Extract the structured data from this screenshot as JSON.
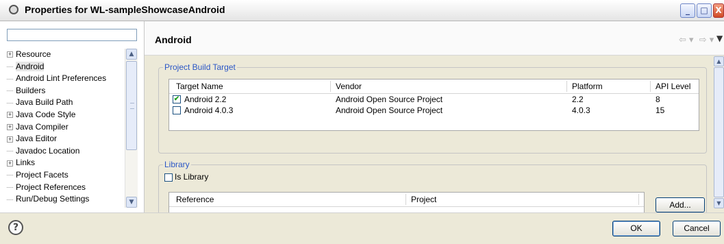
{
  "window": {
    "title": "Properties for WL-sampleShowcaseAndroid"
  },
  "titlebar_buttons": {
    "min": "_",
    "max": "□",
    "close": "X"
  },
  "filter": {
    "value": "",
    "placeholder": ""
  },
  "tree": {
    "items": [
      {
        "label": "Resource",
        "expandable": true,
        "selected": false
      },
      {
        "label": "Android",
        "expandable": false,
        "selected": true
      },
      {
        "label": "Android Lint Preferences",
        "expandable": false,
        "selected": false
      },
      {
        "label": "Builders",
        "expandable": false,
        "selected": false
      },
      {
        "label": "Java Build Path",
        "expandable": false,
        "selected": false
      },
      {
        "label": "Java Code Style",
        "expandable": true,
        "selected": false
      },
      {
        "label": "Java Compiler",
        "expandable": true,
        "selected": false
      },
      {
        "label": "Java Editor",
        "expandable": true,
        "selected": false
      },
      {
        "label": "Javadoc Location",
        "expandable": false,
        "selected": false
      },
      {
        "label": "Links",
        "expandable": true,
        "selected": false
      },
      {
        "label": "Project Facets",
        "expandable": false,
        "selected": false
      },
      {
        "label": "Project References",
        "expandable": false,
        "selected": false
      },
      {
        "label": "Run/Debug Settings",
        "expandable": false,
        "selected": false
      }
    ]
  },
  "page": {
    "title": "Android"
  },
  "build_target": {
    "legend": "Project Build Target",
    "columns": [
      "Target Name",
      "Vendor",
      "Platform",
      "API Level"
    ],
    "rows": [
      {
        "checked": true,
        "name": "Android 2.2",
        "vendor": "Android Open Source Project",
        "platform": "2.2",
        "api": "8"
      },
      {
        "checked": false,
        "name": "Android 4.0.3",
        "vendor": "Android Open Source Project",
        "platform": "4.0.3",
        "api": "15"
      }
    ]
  },
  "library": {
    "legend": "Library",
    "is_library_label": "Is Library",
    "is_library_checked": false,
    "columns": [
      "Reference",
      "Project"
    ],
    "add_button": "Add..."
  },
  "footer": {
    "help": "?",
    "ok": "OK",
    "cancel": "Cancel"
  }
}
